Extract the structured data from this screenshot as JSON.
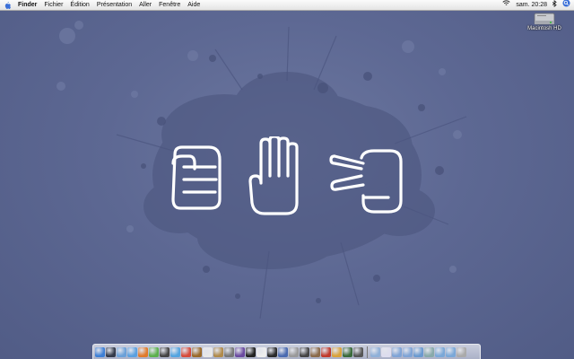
{
  "menubar": {
    "apple_icon": "apple-icon",
    "items": [
      {
        "label": "Finder",
        "bold": true
      },
      {
        "label": "Fichier"
      },
      {
        "label": "Édition"
      },
      {
        "label": "Présentation"
      },
      {
        "label": "Aller"
      },
      {
        "label": "Fenêtre"
      },
      {
        "label": "Aide"
      }
    ],
    "status": {
      "wifi_icon": "wifi-icon",
      "clock": "sam. 20:28",
      "bluetooth_icon": "bluetooth-icon",
      "spotlight_icon": "spotlight-icon"
    }
  },
  "desktop": {
    "drive": {
      "label": "Macintosh HD",
      "icon": "hard-drive-icon"
    },
    "wallpaper_icons": [
      "rock-fist-icon",
      "paper-hand-icon",
      "scissors-hand-icon"
    ]
  },
  "dock": {
    "apps": [
      {
        "icon": "finder-icon",
        "color": "#3d7fd6"
      },
      {
        "icon": "dashboard-icon",
        "color": "#333a4a"
      },
      {
        "icon": "mail-icon",
        "color": "#6aa0d8"
      },
      {
        "icon": "safari-icon",
        "color": "#5aa0e0"
      },
      {
        "icon": "firefox-icon",
        "color": "#e07a2a"
      },
      {
        "icon": "adium-icon",
        "color": "#5bb04c"
      },
      {
        "icon": "dvd-player-icon",
        "color": "#444"
      },
      {
        "icon": "itunes-icon",
        "color": "#53a4e0"
      },
      {
        "icon": "iphoto-icon",
        "color": "#d64a3a"
      },
      {
        "icon": "imovie-icon",
        "color": "#9a6a2a"
      },
      {
        "icon": "calendar-icon",
        "color": "#e8e8e8"
      },
      {
        "icon": "address-book-icon",
        "color": "#b08a4a"
      },
      {
        "icon": "garageband-icon",
        "color": "#777"
      },
      {
        "icon": "preview-icon",
        "color": "#6a4aa0"
      },
      {
        "icon": "terminal-icon",
        "color": "#222"
      },
      {
        "icon": "text-editor-icon",
        "color": "#eee"
      },
      {
        "icon": "chess-icon",
        "color": "#2a2a2a"
      },
      {
        "icon": "quicktime-icon",
        "color": "#4a6ab0"
      },
      {
        "icon": "system-preferences-icon",
        "color": "#999"
      },
      {
        "icon": "pause-icon",
        "color": "#444"
      },
      {
        "icon": "app-store-icon",
        "color": "#8a6a4a"
      },
      {
        "icon": "photo-booth-icon",
        "color": "#c0392b"
      },
      {
        "icon": "widget-icon",
        "color": "#d9a23a"
      },
      {
        "icon": "network-icon",
        "color": "#3a6a3a"
      },
      {
        "icon": "console-icon",
        "color": "#555"
      }
    ],
    "docs": [
      {
        "icon": "folder-icon",
        "color": "#8fb0d8"
      },
      {
        "icon": "document-icon",
        "color": "#dde"
      },
      {
        "icon": "applications-folder-icon",
        "color": "#7fa4d6"
      },
      {
        "icon": "downloads-folder-icon",
        "color": "#7fa4d6"
      },
      {
        "icon": "stack-icon",
        "color": "#6a9ad0"
      },
      {
        "icon": "utilities-folder-icon",
        "color": "#8aa"
      },
      {
        "icon": "photos-folder-icon",
        "color": "#7aa8d8"
      },
      {
        "icon": "music-folder-icon",
        "color": "#7aa8d8"
      },
      {
        "icon": "trash-icon",
        "color": "#aaa"
      }
    ]
  }
}
